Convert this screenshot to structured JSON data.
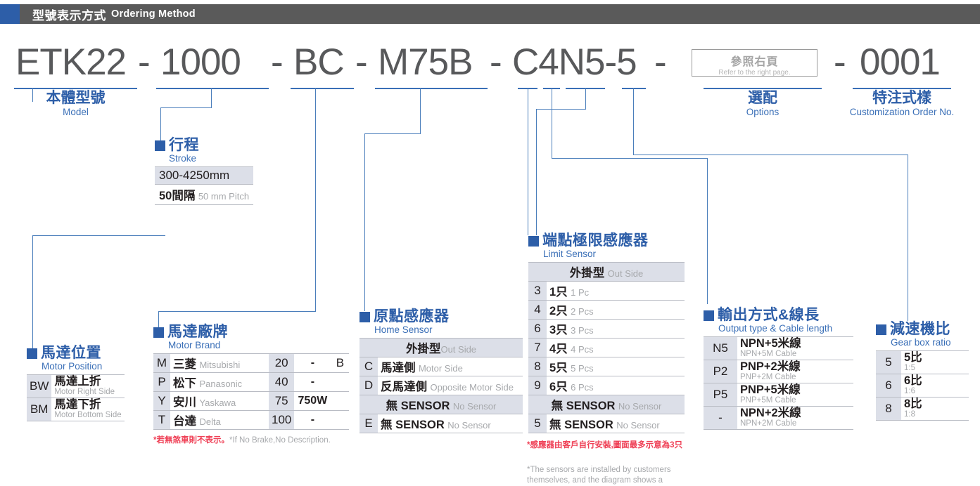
{
  "header": {
    "cn": "型號表示方式",
    "en": "Ordering Method"
  },
  "model_string": {
    "segments": [
      {
        "text": "ETK22"
      },
      {
        "text": "1000"
      },
      {
        "text": "BC"
      },
      {
        "text": "M75B"
      },
      {
        "text": "C4N5-5"
      },
      {
        "text": "0001"
      }
    ],
    "dash": "-",
    "ref_box": {
      "cn": "參照右頁",
      "en": "Refer to the right page."
    }
  },
  "labels": {
    "model": {
      "cn": "本體型號",
      "en": "Model"
    },
    "options": {
      "cn": "選配",
      "en": "Options"
    },
    "customization": {
      "cn": "特注式樣",
      "en": "Customization Order No."
    }
  },
  "stroke": {
    "cn": "行程",
    "en": "Stroke",
    "range": "300-4250mm",
    "pitch_cn": "50間隔",
    "pitch_en": "50 mm Pitch"
  },
  "motor_position": {
    "cn": "馬達位置",
    "en": "Motor Position",
    "rows": [
      {
        "code": "BW",
        "cn": "馬達上折",
        "en": "Motor Right Side"
      },
      {
        "code": "BM",
        "cn": "馬達下折",
        "en": "Motor Bottom Side"
      }
    ]
  },
  "motor_brand": {
    "cn": "馬達廠牌",
    "en": "Motor Brand",
    "rows": [
      {
        "code": "M",
        "cn": "三菱",
        "en": "Mitsubishi",
        "power": "20",
        "watt": "-",
        "brake": "B"
      },
      {
        "code": "P",
        "cn": "松下",
        "en": "Panasonic",
        "power": "40",
        "watt": "-",
        "brake": ""
      },
      {
        "code": "Y",
        "cn": "安川",
        "en": "Yaskawa",
        "power": "75",
        "watt": "750W",
        "brake": ""
      },
      {
        "code": "T",
        "cn": "台達",
        "en": "Delta",
        "power": "100",
        "watt": "-",
        "brake": ""
      }
    ],
    "note_cn": "*若無煞車則不表示。",
    "note_en": "*If No Brake,No Description."
  },
  "home_sensor": {
    "cn": "原點感應器",
    "en": "Home Sensor",
    "band1_cn": "外掛型",
    "band1_en": "Out Side",
    "rows1": [
      {
        "code": "C",
        "cn": "馬達側",
        "en": "Motor Side"
      },
      {
        "code": "D",
        "cn": "反馬達側",
        "en": "Opposite Motor Side"
      }
    ],
    "band2_cn": "無 SENSOR",
    "band2_en": "No Sensor",
    "rows2": [
      {
        "code": "E",
        "cn": "無 SENSOR",
        "en": "No Sensor"
      }
    ]
  },
  "limit_sensor": {
    "cn": "端點極限感應器",
    "en": "Limit Sensor",
    "band1_cn": "外掛型",
    "band1_en": "Out Side",
    "rows1": [
      {
        "code": "3",
        "cn": "1只",
        "en": "1 Pc"
      },
      {
        "code": "4",
        "cn": "2只",
        "en": "2 Pcs"
      },
      {
        "code": "6",
        "cn": "3只",
        "en": "3 Pcs"
      },
      {
        "code": "7",
        "cn": "4只",
        "en": "4 Pcs"
      },
      {
        "code": "8",
        "cn": "5只",
        "en": "5 Pcs"
      },
      {
        "code": "9",
        "cn": "6只",
        "en": "6 Pcs"
      }
    ],
    "band2_cn": "無 SENSOR",
    "band2_en": "No Sensor",
    "rows2": [
      {
        "code": "5",
        "cn": "無 SENSOR",
        "en": "No Sensor"
      }
    ],
    "note_cn": "*感應器由客戶自行安裝,圖面最多示意為3只",
    "note_en": "*The sensors are installed by customers themselves, and the diagram shows a"
  },
  "output_type": {
    "cn": "輸出方式&線長",
    "en": "Output type & Cable length",
    "rows": [
      {
        "code": "N5",
        "cn": "NPN+5米線",
        "en": "NPN+5M Cable"
      },
      {
        "code": "P2",
        "cn": "PNP+2米線",
        "en": "PNP+2M Cable"
      },
      {
        "code": "P5",
        "cn": "PNP+5米線",
        "en": "PNP+5M Cable"
      },
      {
        "code": "-",
        "cn": "NPN+2米線",
        "en": "NPN+2M Cable"
      }
    ]
  },
  "gear_ratio": {
    "cn": "減速機比",
    "en": "Gear box ratio",
    "rows": [
      {
        "code": "5",
        "cn": "5比",
        "en": "1:5"
      },
      {
        "code": "6",
        "cn": "6比",
        "en": "1:6"
      },
      {
        "code": "8",
        "cn": "8比",
        "en": "1:8"
      }
    ]
  },
  "colors": {
    "brand_blue": "#2d5ea8",
    "line_blue": "#4a7ebb",
    "header_gray": "#5a5a5a",
    "code_gray": "#58595b",
    "note_red": "#ef4056"
  }
}
